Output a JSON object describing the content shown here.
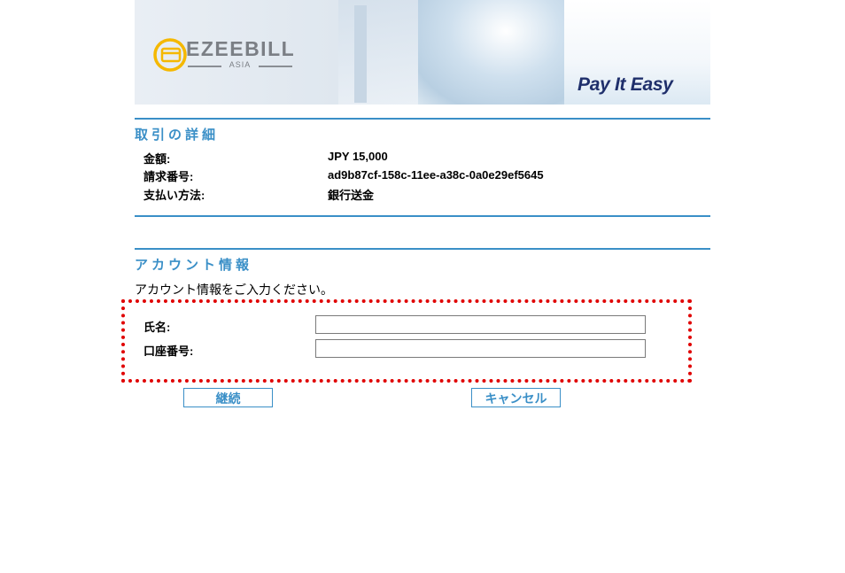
{
  "brand": {
    "logo_text": "EZEEBILL",
    "logo_subtext": "ASIA",
    "tagline": "Pay It Easy"
  },
  "transaction": {
    "section_title": "取引の詳細",
    "rows": [
      {
        "label": "金額:",
        "value": "JPY 15,000"
      },
      {
        "label": "請求番号:",
        "value": "ad9b87cf-158c-11ee-a38c-0a0e29ef5645"
      },
      {
        "label": "支払い方法:",
        "value": "銀行送金"
      }
    ]
  },
  "account": {
    "section_title": "アカウント情報",
    "instruction": "アカウント情報をご入力ください。",
    "fields": [
      {
        "label": "氏名:",
        "value": "",
        "placeholder": ""
      },
      {
        "label": "口座番号:",
        "value": "",
        "placeholder": ""
      }
    ]
  },
  "actions": {
    "continue_label": "継続",
    "cancel_label": "キャンセル"
  },
  "colors": {
    "accent": "#3a8fc7",
    "tagline": "#1f2f6b",
    "highlight": "#e00000",
    "logo_ring": "#f5b800"
  }
}
